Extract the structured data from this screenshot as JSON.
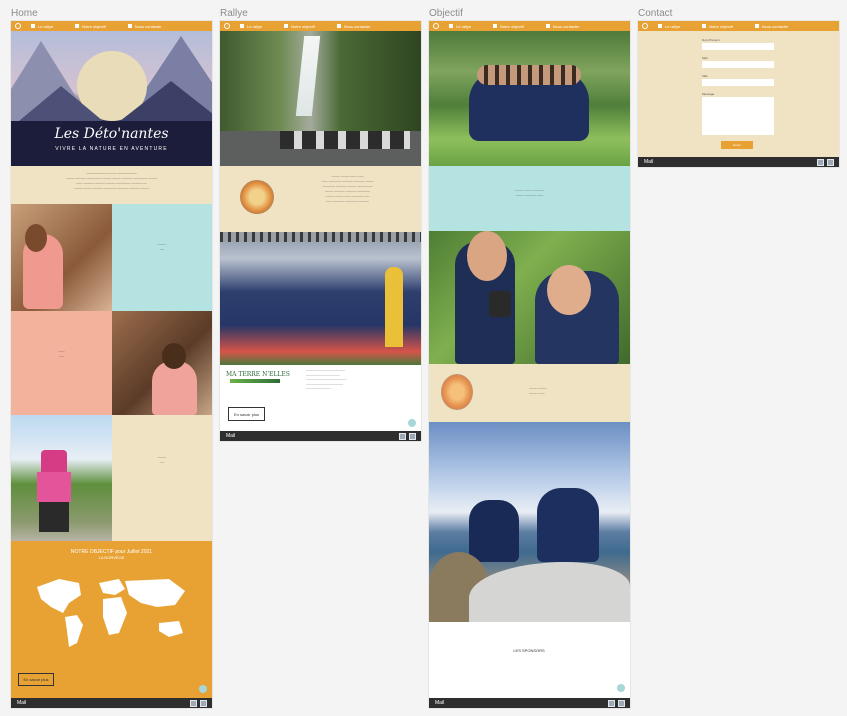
{
  "nav": {
    "items": [
      {
        "label": "Le rallye",
        "icon": "rally-icon"
      },
      {
        "label": "Notre objectif",
        "icon": "target-icon"
      },
      {
        "label": "Nous contacter",
        "icon": "mail-icon"
      }
    ]
  },
  "frames": {
    "home": "Home",
    "rallye": "Rallye",
    "objectif": "Objectif",
    "contact": "Contact"
  },
  "home": {
    "hero_title": "Les Déto'nantes",
    "hero_subtitle": "VIVRE LA NATURE EN AVENTURE",
    "goal_heading": "NOTRE OBJECTIF pour Juillet 2021",
    "goal_sub": "LA NORVÈGE",
    "cta": "En savoir plus",
    "footer": "Mail"
  },
  "rallye": {
    "brand": "MA TERRE N'ELLES",
    "cta": "En savoir plus",
    "footer": "Mail"
  },
  "objectif": {
    "sponsors": "LES SPONSORS",
    "footer": "Mail"
  },
  "contact": {
    "fields": [
      "Nom Prénom",
      "Mail",
      "Ville",
      "Message"
    ],
    "submit": "Envoi",
    "footer": "Mail"
  },
  "colors": {
    "accent": "#e8a234",
    "beige": "#efe3c4",
    "mint": "#b4e3e2",
    "peach": "#f3b29b",
    "footer": "#2e2e2e"
  }
}
